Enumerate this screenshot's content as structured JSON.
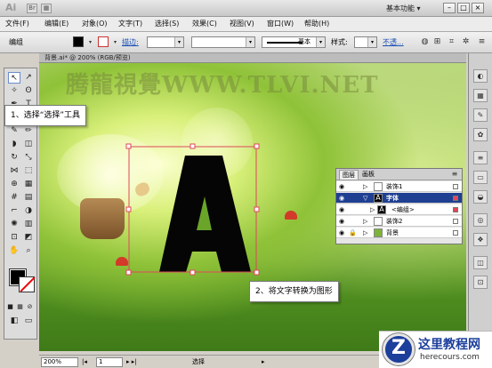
{
  "titlebar": {
    "app_logo": "Ai",
    "workspace": "基本功能 ▾",
    "window_buttons": [
      "–",
      "□",
      "×"
    ]
  },
  "menubar": {
    "items": [
      "文件(F)",
      "编辑(E)",
      "对象(O)",
      "文字(T)",
      "选择(S)",
      "效果(C)",
      "视图(V)",
      "窗口(W)",
      "帮助(H)"
    ]
  },
  "control_bar": {
    "group_label": "编组",
    "stroke_label": "描边:",
    "brush_value": "基本",
    "style_label": "样式:",
    "opacity_label": "不透..."
  },
  "document": {
    "tab_title": "背景.ai* @ 200% (RGB/预览)"
  },
  "canvas": {
    "watermark": "腾龍視覺WWW.TLVI.NET",
    "letter": "A"
  },
  "callouts": {
    "step1": "1、选择“选择”工具",
    "step2": "2、将文字转换为图形"
  },
  "layers_panel": {
    "tabs": [
      "图层",
      "画板"
    ],
    "rows": [
      {
        "name": "装饰1",
        "expand": "▷",
        "selected": false
      },
      {
        "name": "字体",
        "expand": "▽",
        "selected": true
      },
      {
        "name": "<编组>",
        "expand": "▷",
        "selected": false
      },
      {
        "name": "装饰2",
        "expand": "▷",
        "selected": false
      },
      {
        "name": "背景",
        "expand": "▷",
        "selected": false
      }
    ]
  },
  "statusbar": {
    "zoom": "200%",
    "page": "1",
    "tool": "选择"
  },
  "site_logo": {
    "glyph": "Z",
    "name": "这里教程网",
    "url": "herecours.com"
  },
  "colors": {
    "selection_accent": "#e0475a",
    "layer_selected": "#1f3f92",
    "logo_blue": "#1c3f9c"
  }
}
